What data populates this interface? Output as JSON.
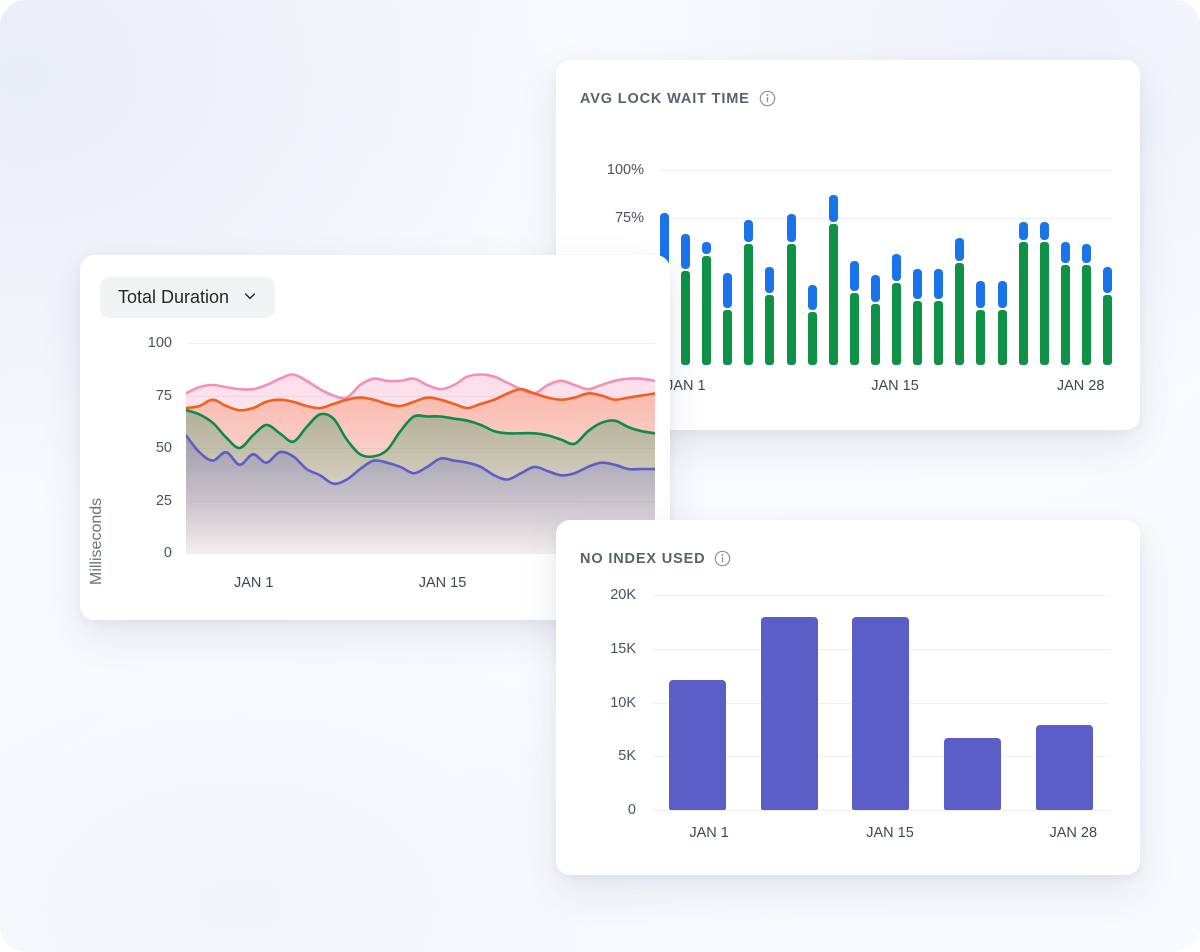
{
  "theme": {
    "bar_blue": "#1a73e8",
    "bar_green": "#0f9247",
    "bar_purple": "#5b5ec7",
    "line_pink": "#f48fb8",
    "line_orange": "#f0601f",
    "line_green": "#0c8a4e",
    "line_purple": "#5b5ec7",
    "grid": "#edeff3",
    "title_text": "#5a6270"
  },
  "cards": {
    "lock_wait": {
      "title": "AVG LOCK WAIT TIME",
      "info_icon": "info-icon"
    },
    "total_duration": {
      "select_label": "Total Duration",
      "select_icon": "chevron-down-icon",
      "axis_title": "Milliseconds"
    },
    "no_index": {
      "title": "NO INDEX USED",
      "info_icon": "info-icon"
    }
  },
  "chart_data": [
    {
      "id": "avg_lock_wait_time",
      "type": "bar",
      "title": "AVG LOCK WAIT TIME",
      "stacked": true,
      "xlabel": "",
      "ylabel": "",
      "ylim": [
        0,
        110
      ],
      "yticks": [
        100,
        75
      ],
      "ytick_labels": [
        "100%",
        "75%"
      ],
      "xtick_labels": [
        "JAN 1",
        "JAN 15",
        "JAN 28"
      ],
      "xtick_positions": [
        0.055,
        0.5,
        0.895
      ],
      "grid": true,
      "legend": "none",
      "series": [
        {
          "name": "lower",
          "color": "#0f9247",
          "values": [
            0,
            48,
            56,
            28,
            62,
            36,
            62,
            27,
            72,
            37,
            31,
            42,
            33,
            33,
            52,
            28,
            28,
            63,
            63,
            51,
            51,
            36
          ]
        },
        {
          "name": "upper",
          "color": "#1a73e8",
          "values": [
            78,
            66,
            62,
            46,
            73,
            49,
            76,
            40,
            86,
            52,
            45,
            56,
            48,
            48,
            64,
            42,
            42,
            72,
            72,
            62,
            61,
            49
          ]
        }
      ]
    },
    {
      "id": "total_duration",
      "type": "area",
      "title": "Total Duration",
      "xlabel": "",
      "ylabel": "Milliseconds",
      "ylim": [
        0,
        100
      ],
      "yticks": [
        100,
        75,
        50,
        25,
        0
      ],
      "ytick_labels": [
        "100",
        "75",
        "50",
        "25",
        "0"
      ],
      "xtick_labels": [
        "JAN 1",
        "JAN 15"
      ],
      "xtick_positions": [
        0.14,
        0.53
      ],
      "grid": true,
      "legend": "none",
      "series": [
        {
          "name": "series-pink",
          "color": "#f48fb8",
          "values": [
            76,
            79,
            80,
            79,
            78,
            78,
            80,
            83,
            85,
            82,
            78,
            75,
            74,
            80,
            83,
            82,
            82,
            83,
            80,
            78,
            80,
            84,
            85,
            84,
            81,
            78,
            76,
            80,
            82,
            80,
            78,
            80,
            82,
            83,
            83,
            82
          ]
        },
        {
          "name": "series-orange",
          "color": "#f0601f",
          "values": [
            69,
            70,
            73,
            70,
            68,
            69,
            72,
            73,
            72,
            70,
            69,
            71,
            73,
            74,
            73,
            71,
            70,
            72,
            74,
            73,
            71,
            69,
            71,
            73,
            76,
            78,
            76,
            74,
            73,
            74,
            76,
            75,
            73,
            74,
            75,
            76
          ]
        },
        {
          "name": "series-green",
          "color": "#0c8a4e",
          "values": [
            68,
            66,
            62,
            55,
            50,
            56,
            61,
            57,
            53,
            60,
            66,
            64,
            54,
            47,
            46,
            49,
            58,
            65,
            65,
            65,
            64,
            63,
            61,
            58,
            57,
            57,
            57,
            56,
            54,
            52,
            58,
            62,
            63,
            60,
            58,
            57
          ]
        },
        {
          "name": "series-purple",
          "color": "#5b5ec7",
          "values": [
            56,
            48,
            44,
            48,
            42,
            47,
            43,
            48,
            46,
            40,
            37,
            33,
            35,
            40,
            44,
            43,
            41,
            38,
            41,
            45,
            44,
            43,
            41,
            37,
            35,
            38,
            41,
            39,
            37,
            38,
            41,
            43,
            42,
            40,
            40,
            40
          ]
        }
      ]
    },
    {
      "id": "no_index_used",
      "type": "bar",
      "title": "NO INDEX USED",
      "xlabel": "",
      "ylabel": "",
      "ylim": [
        0,
        20000
      ],
      "yticks": [
        20000,
        15000,
        10000,
        5000,
        0
      ],
      "ytick_labels": [
        "20K",
        "15K",
        "10K",
        "5K",
        "0"
      ],
      "categories": [
        "JAN 1",
        "",
        "JAN 15",
        "",
        "JAN 28"
      ],
      "xtick_labels": [
        "JAN 1",
        "JAN 15",
        "JAN 28"
      ],
      "xtick_positions": [
        0.12,
        0.5,
        0.885
      ],
      "values": [
        12100,
        18000,
        18000,
        6700,
        7900
      ],
      "grid": true,
      "legend": "none",
      "color": "#5b5ec7"
    }
  ]
}
